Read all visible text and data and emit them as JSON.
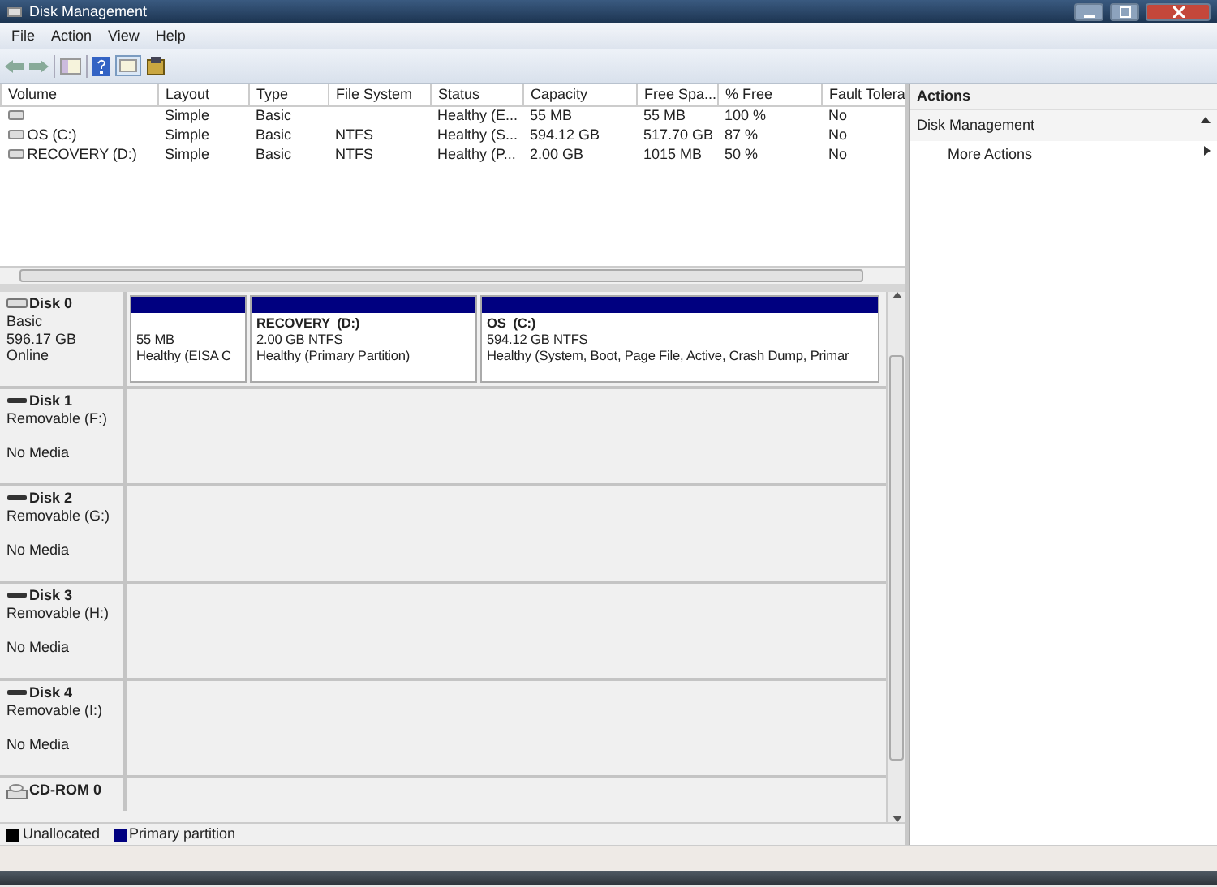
{
  "window": {
    "title": "Disk Management"
  },
  "menu": [
    "File",
    "Action",
    "View",
    "Help"
  ],
  "volume_table": {
    "columns": [
      "Volume",
      "Layout",
      "Type",
      "File System",
      "Status",
      "Capacity",
      "Free Spa...",
      "% Free",
      "Fault Tolera"
    ],
    "rows": [
      [
        "",
        "Simple",
        "Basic",
        "",
        "Healthy (E...",
        "55 MB",
        "55 MB",
        "100 %",
        "No"
      ],
      [
        "OS (C:)",
        "Simple",
        "Basic",
        "NTFS",
        "Healthy (S...",
        "594.12 GB",
        "517.70 GB",
        "87 %",
        "No"
      ],
      [
        "RECOVERY (D:)",
        "Simple",
        "Basic",
        "NTFS",
        "Healthy (P...",
        "2.00 GB",
        "1015 MB",
        "50 %",
        "No"
      ]
    ]
  },
  "disks": [
    {
      "kind": "fixed",
      "name": "Disk 0",
      "lines": [
        "Basic",
        "596.17 GB",
        "Online"
      ],
      "partitions": [
        {
          "size": "55 MB",
          "status": "Healthy (EISA C"
        },
        {
          "name": "RECOVERY  (D:)",
          "size": "2.00 GB NTFS",
          "status": "Healthy (Primary Partition)"
        },
        {
          "name": "OS  (C:)",
          "size": "594.12 GB NTFS",
          "status": "Healthy (System, Boot, Page File, Active, Crash Dump, Primar"
        }
      ]
    },
    {
      "kind": "removable",
      "name": "Disk 1",
      "lines": [
        "Removable (F:)"
      ],
      "media": "No Media"
    },
    {
      "kind": "removable",
      "name": "Disk 2",
      "lines": [
        "Removable (G:)"
      ],
      "media": "No Media"
    },
    {
      "kind": "removable",
      "name": "Disk 3",
      "lines": [
        "Removable (H:)"
      ],
      "media": "No Media"
    },
    {
      "kind": "removable",
      "name": "Disk 4",
      "lines": [
        "Removable (I:)"
      ],
      "media": "No Media"
    },
    {
      "kind": "cdrom",
      "name": "CD-ROM 0"
    }
  ],
  "legend": [
    {
      "label": "Unallocated",
      "color": "#000000"
    },
    {
      "label": "Primary partition",
      "color": "#000080"
    }
  ],
  "actions": {
    "title": "Actions",
    "section": "Disk Management",
    "items": [
      "More Actions"
    ]
  }
}
